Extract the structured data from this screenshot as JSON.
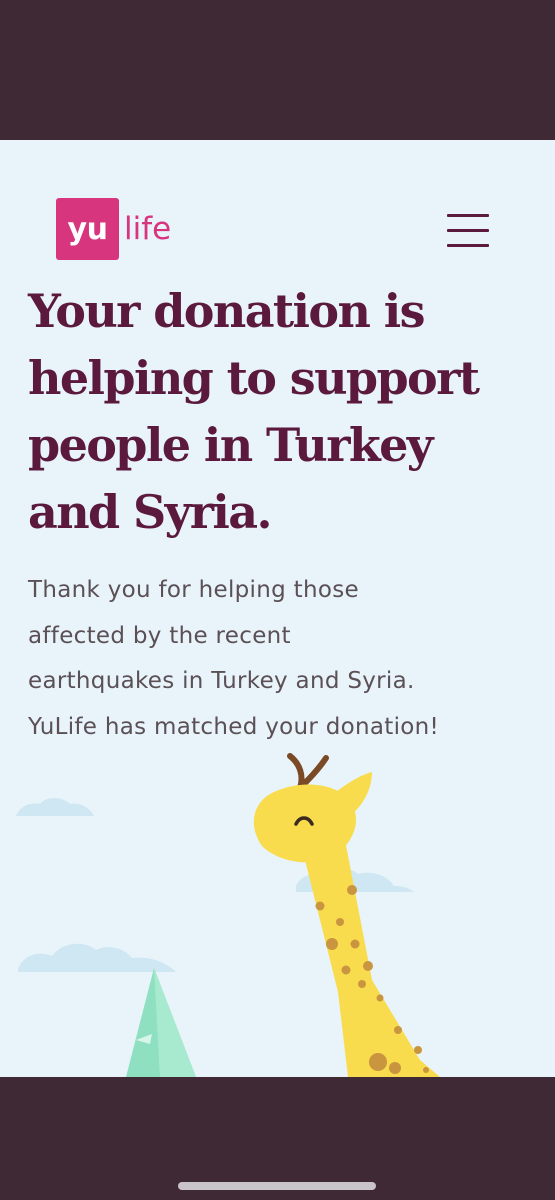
{
  "header": {
    "logo_mark": "yu",
    "logo_word": "life",
    "menu_icon": "hamburger-menu-icon"
  },
  "main": {
    "headline_lines": [
      "Your donation is",
      "helping to support",
      "people in Turkey",
      "and Syria."
    ],
    "body_lines": [
      "Thank you for helping those",
      "affected by the recent",
      "earthquakes in Turkey and Syria.",
      "YuLife has matched your donation!"
    ]
  },
  "illustration": {
    "subjects": [
      "giraffe",
      "clouds",
      "tree"
    ]
  },
  "colors": {
    "background": "#e8f4fa",
    "brand_pink": "#d8357f",
    "headline": "#5b1a3d",
    "body_text": "#5a5055",
    "frame": "#3e2935",
    "giraffe": "#f8dc4e",
    "giraffe_spots": "#c9953e",
    "cloud": "#cfe6f3",
    "tree": "#8ee0c0"
  }
}
